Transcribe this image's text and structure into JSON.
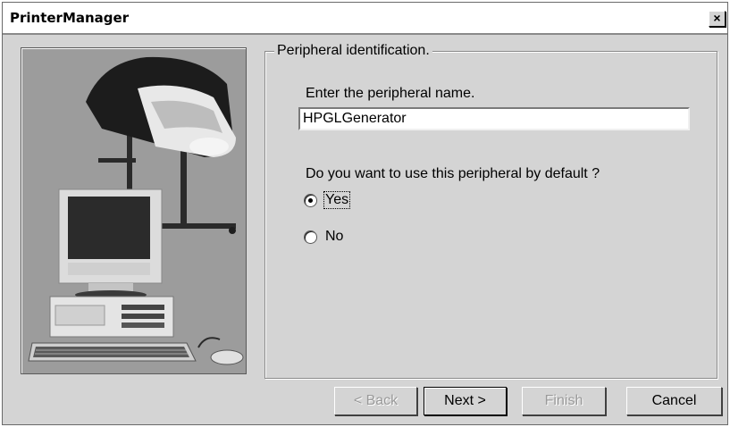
{
  "window": {
    "title": "PrinterManager",
    "close_glyph": "×"
  },
  "illustration": {
    "icon": "printer-and-computer-illustration"
  },
  "group": {
    "legend": "Peripheral identification.",
    "name_label": "Enter the peripheral name.",
    "name_value": "HPGLGenerator",
    "default_question": "Do you want to use this peripheral by default ?",
    "options": [
      {
        "label": "Yes",
        "selected": true
      },
      {
        "label": "No",
        "selected": false
      }
    ]
  },
  "buttons": {
    "back": "< Back",
    "next": "Next >",
    "finish": "Finish",
    "cancel": "Cancel"
  }
}
